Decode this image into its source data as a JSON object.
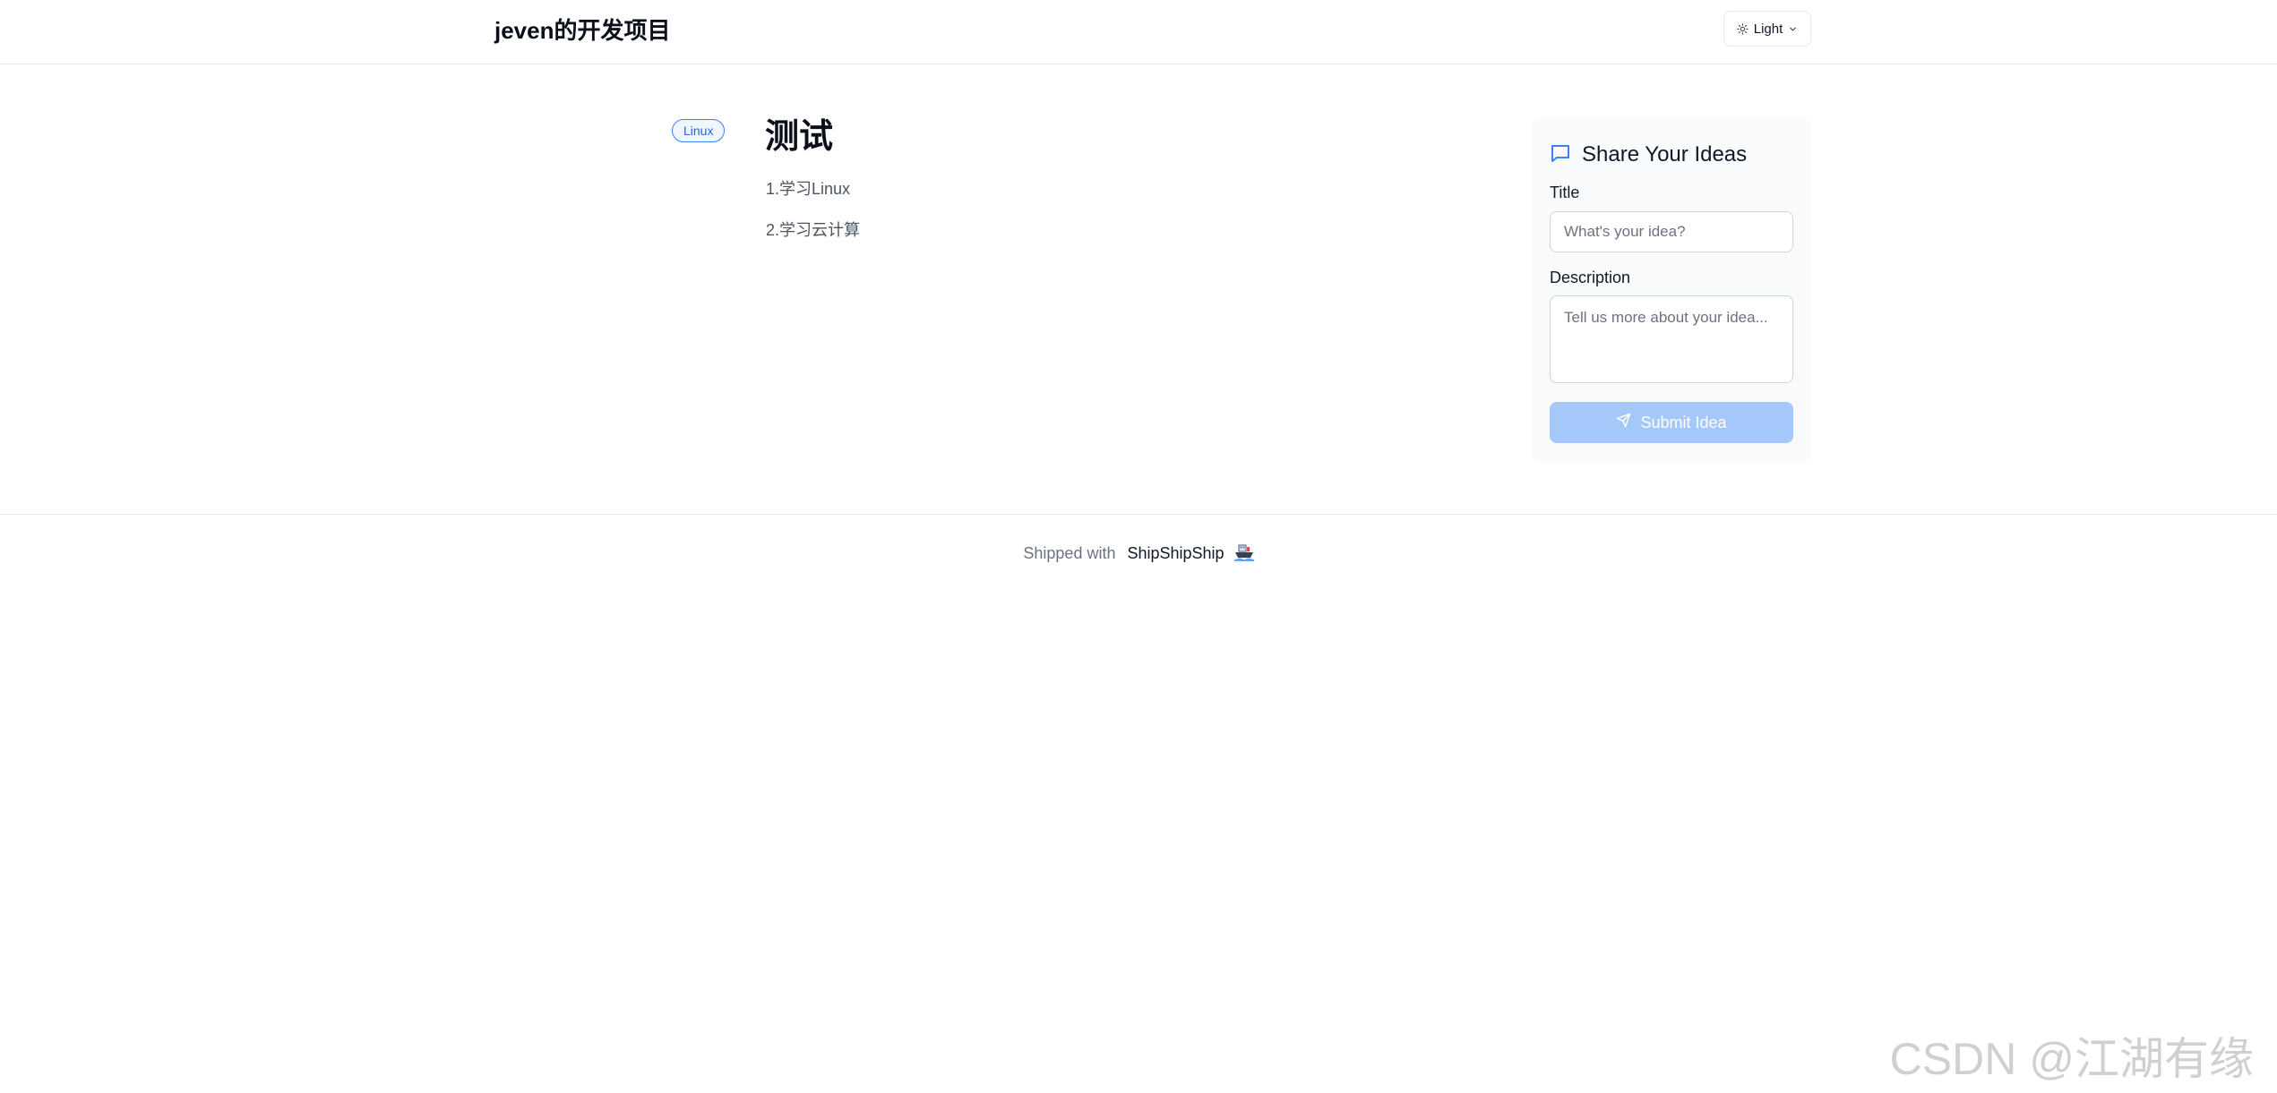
{
  "header": {
    "site_title": "jeven的开发项目",
    "theme_label": "Light"
  },
  "project": {
    "tag": "Linux",
    "title": "测试",
    "items": [
      "1.学习Linux",
      "2.学习云计算"
    ]
  },
  "ideas_form": {
    "heading": "Share Your Ideas",
    "title_label": "Title",
    "title_placeholder": "What's your idea?",
    "title_value": "",
    "description_label": "Description",
    "description_placeholder": "Tell us more about your idea...",
    "description_value": "",
    "submit_label": "Submit Idea"
  },
  "footer": {
    "prefix": "Shipped with",
    "link_label": "ShipShipShip"
  },
  "watermark": "CSDN @江湖有缘",
  "colors": {
    "accent": "#3b82f6",
    "submit_disabled": "#a5c8fb",
    "card_bg": "#f8fafc"
  },
  "icons": {
    "theme": "sun-icon",
    "theme_menu": "chevron-down-icon",
    "ideas": "chat-bubble-icon",
    "submit": "send-icon",
    "footer": "ship-icon"
  }
}
